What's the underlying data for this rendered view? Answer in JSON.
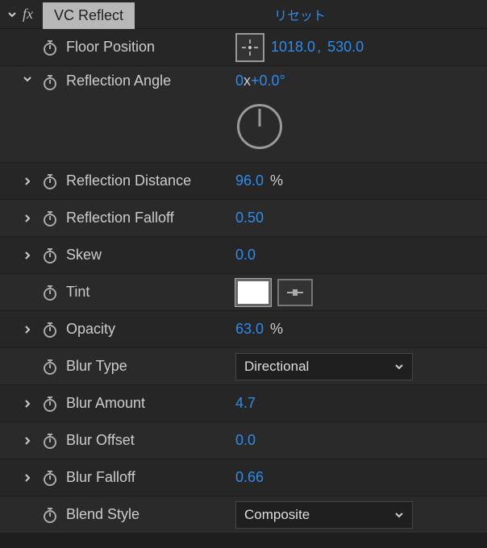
{
  "header": {
    "fx_label": "fx",
    "effect_name": "VC Reflect",
    "reset_label": "リセット"
  },
  "props": {
    "floor_position": {
      "label": "Floor Position",
      "x": "1018.0",
      "y": "530.0"
    },
    "reflection_angle": {
      "label": "Reflection Angle",
      "revs": "0",
      "x_sep": "x",
      "deg": "+0.0",
      "unit": "°"
    },
    "reflection_distance": {
      "label": "Reflection Distance",
      "value": "96.0",
      "unit": "%"
    },
    "reflection_falloff": {
      "label": "Reflection Falloff",
      "value": "0.50"
    },
    "skew": {
      "label": "Skew",
      "value": "0.0"
    },
    "tint": {
      "label": "Tint"
    },
    "opacity": {
      "label": "Opacity",
      "value": "63.0",
      "unit": "%"
    },
    "blur_type": {
      "label": "Blur Type",
      "value": "Directional"
    },
    "blur_amount": {
      "label": "Blur Amount",
      "value": "4.7"
    },
    "blur_offset": {
      "label": "Blur Offset",
      "value": "0.0"
    },
    "blur_falloff": {
      "label": "Blur Falloff",
      "value": "0.66"
    },
    "blend_style": {
      "label": "Blend Style",
      "value": "Composite"
    }
  }
}
